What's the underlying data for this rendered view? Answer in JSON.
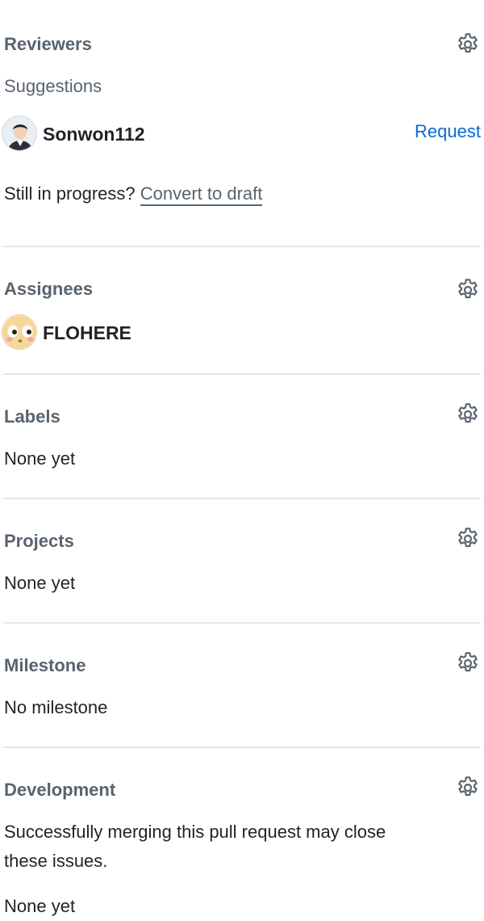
{
  "reviewers": {
    "heading": "Reviewers",
    "suggestions_label": "Suggestions",
    "suggested_user": "Sonwon112",
    "request_label": "Request",
    "draft_prompt": "Still in progress?",
    "convert_label": "Convert to draft"
  },
  "assignees": {
    "heading": "Assignees",
    "user": "FLOHERE"
  },
  "labels": {
    "heading": "Labels",
    "value": "None yet"
  },
  "projects": {
    "heading": "Projects",
    "value": "None yet"
  },
  "milestone": {
    "heading": "Milestone",
    "value": "No milestone"
  },
  "development": {
    "heading": "Development",
    "description_line1": "Successfully merging this pull request may close",
    "description_line2": "these issues.",
    "value": "None yet"
  },
  "icons": {
    "settings": "gear-icon"
  },
  "colors": {
    "link": "#0969da",
    "heading": "#59636e",
    "text": "#1f2328",
    "divider": "#e5e7ea"
  }
}
